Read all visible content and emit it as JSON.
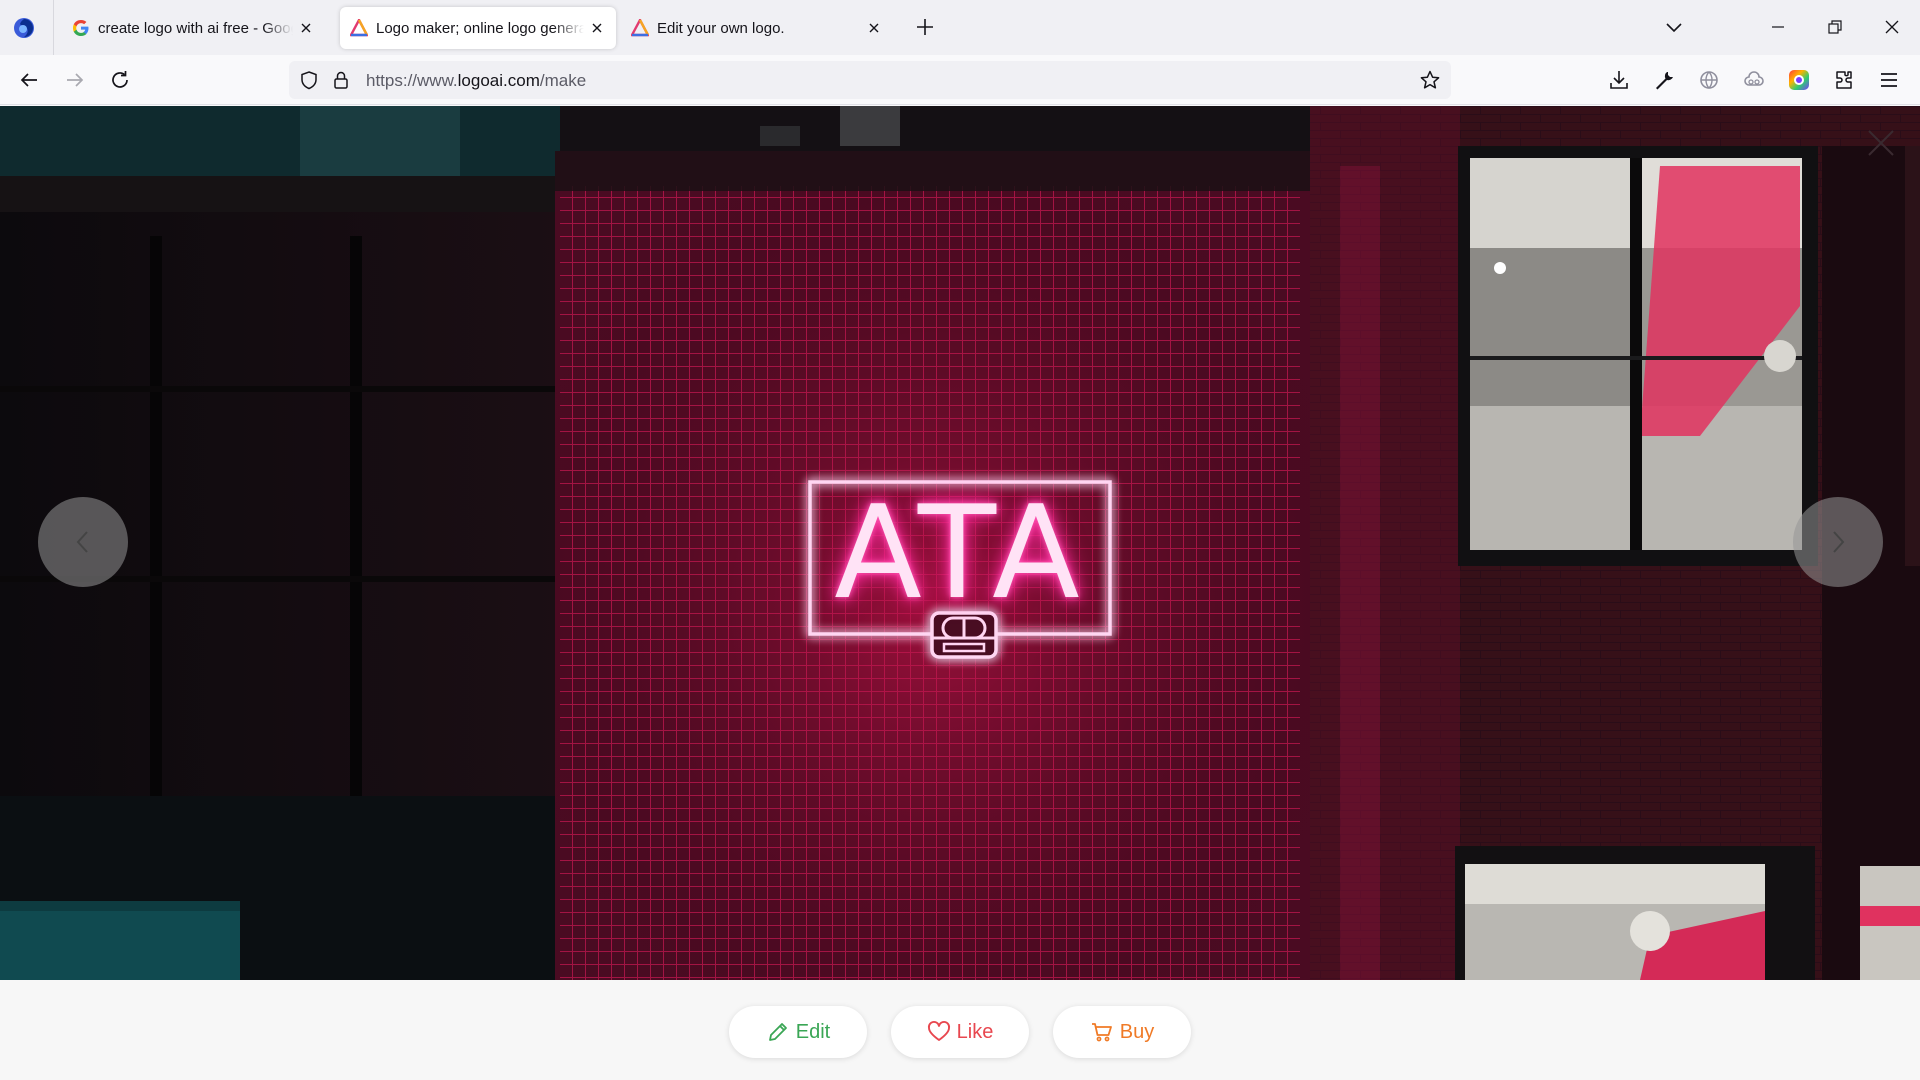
{
  "browser": {
    "tabs": [
      {
        "title": "create logo with ai free - Google Search",
        "favicon": "google-icon"
      },
      {
        "title": "Logo maker; online logo generator",
        "favicon": "logoai-icon",
        "active": true
      },
      {
        "title": "Edit your own logo.",
        "favicon": "logoai-icon"
      }
    ],
    "url_prefix": "https://www.",
    "url_host": "logoai.com",
    "url_path": "/make"
  },
  "logo": {
    "text": "ATA",
    "icon": "vinyl-record-player-icon",
    "color": "#ffd6f2",
    "glow": "#ff2a9d"
  },
  "actions": {
    "edit_label": "Edit",
    "like_label": "Like",
    "buy_label": "Buy",
    "edit_color": "#3aa655",
    "like_color": "#e8474f",
    "buy_color": "#f07a26"
  }
}
